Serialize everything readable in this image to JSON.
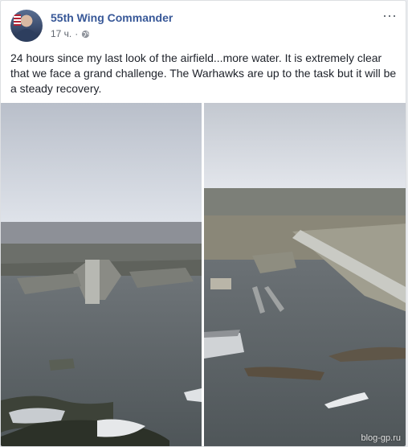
{
  "post": {
    "author": "55th Wing Commander",
    "time": "17 ч.",
    "separator": "·",
    "privacy_icon": "globe-icon",
    "menu_icon": "more-horizontal-icon",
    "text": "24 hours since my last look of the airfield...more water. It is extremely clear that we face a grand challenge. The Warhawks are up to the task but it will be a steady recovery."
  },
  "watermark": "blog-gp.ru",
  "colors": {
    "link": "#385898",
    "text": "#1d2129",
    "meta": "#616770"
  }
}
